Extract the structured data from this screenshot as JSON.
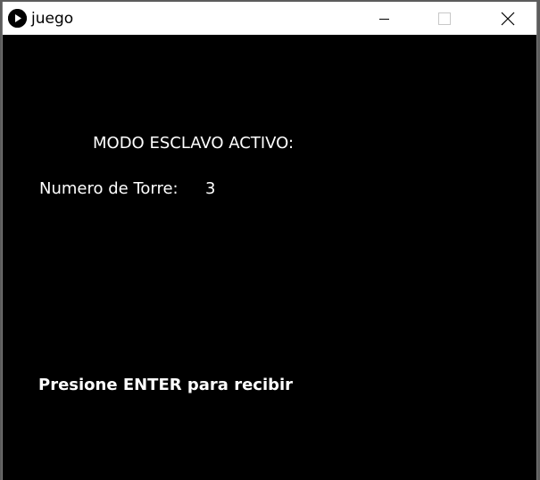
{
  "window": {
    "title": "juego",
    "icon": "play-icon",
    "controls": {
      "minimize": "minimize-icon",
      "maximize": "maximize-icon",
      "close": "close-icon"
    }
  },
  "main": {
    "mode_text": "MODO ESCLAVO ACTIVO:",
    "tower_label": "Numero de Torre:",
    "tower_number": "3",
    "prompt_text": "Presione ENTER para recibir"
  },
  "colors": {
    "canvas_background": "#000000",
    "text": "#ffffff",
    "titlebar": "#ffffff"
  }
}
